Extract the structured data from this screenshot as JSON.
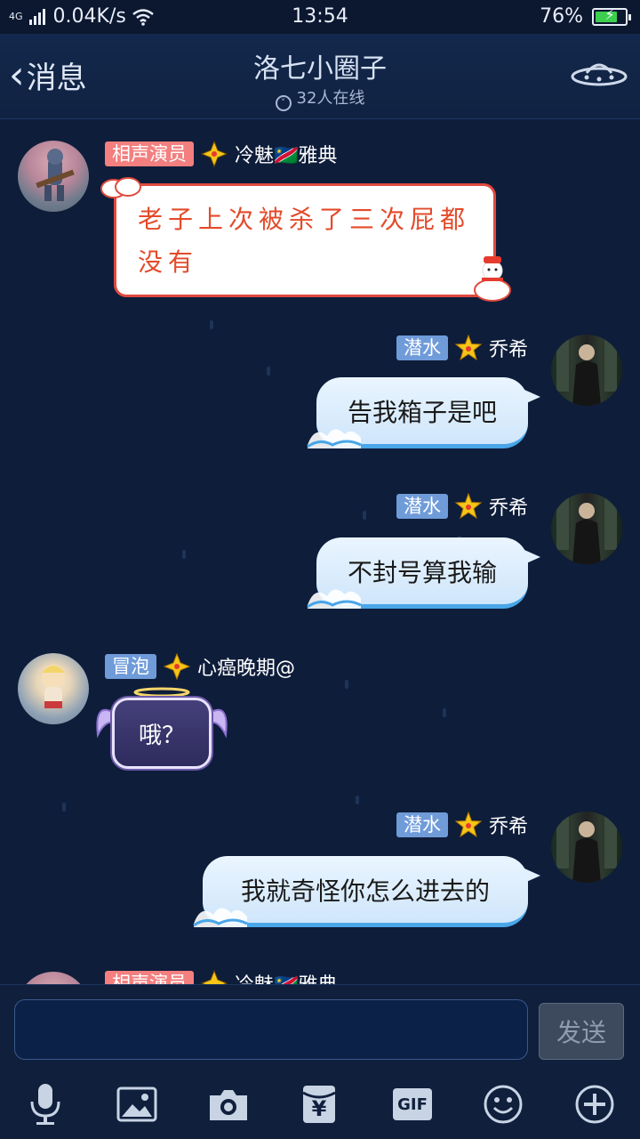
{
  "status_bar": {
    "network": "4G",
    "speed": "0.04K/s",
    "time": "13:54",
    "battery": "76%",
    "battery_level": 0.76
  },
  "header": {
    "back_label": "消息",
    "title": "洛七小圈子",
    "online": "32人在线"
  },
  "messages": [
    {
      "side": "left",
      "badge": "相声演员",
      "name": "冷魅🇳🇦雅典",
      "text": "老子上次被杀了三次屁都没有",
      "bubble": "red"
    },
    {
      "side": "right",
      "badge": "潜水",
      "name": "乔希",
      "text": "告我箱子是吧",
      "bubble": "blue"
    },
    {
      "side": "right",
      "badge": "潜水",
      "name": "乔希",
      "text": "不封号算我输",
      "bubble": "blue"
    },
    {
      "side": "left",
      "badge": "冒泡",
      "name": "心癌晚期@",
      "text": "哦？",
      "bubble": "purple"
    },
    {
      "side": "right",
      "badge": "潜水",
      "name": "乔希",
      "text": "我就奇怪你怎么进去的",
      "bubble": "blue"
    },
    {
      "side": "left",
      "badge": "相声演员",
      "name": "冷魅🇳🇦雅典",
      "text": "",
      "bubble": "partial"
    }
  ],
  "input": {
    "value": "",
    "send_label": "发送"
  },
  "toolbar": {
    "items": [
      "mic-icon",
      "image-icon",
      "camera-icon",
      "red-packet-icon",
      "gif-icon",
      "emoji-icon",
      "plus-icon"
    ],
    "gif_label": "GIF",
    "yen": "¥"
  },
  "colors": {
    "background": "#0e1d3a",
    "badge_pink": "#f37f7f",
    "badge_blue": "#6f9bd9",
    "bubble_blue": "#cfe6fb",
    "red_bubble_border": "#e04a3e"
  }
}
